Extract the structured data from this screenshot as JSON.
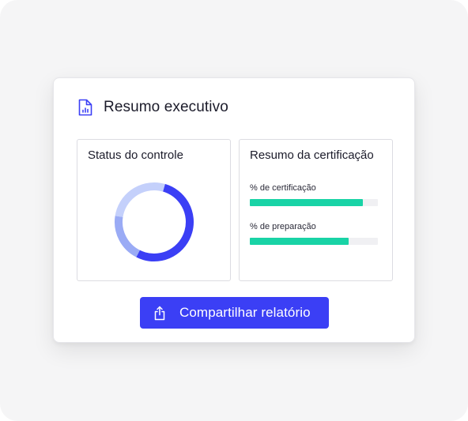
{
  "colors": {
    "accent": "#3b3ff5",
    "progress": "#19d3a6",
    "donut_dark": "#3b3ff5",
    "donut_mid": "#9aabf5",
    "donut_light": "#c4d0fb"
  },
  "icons": {
    "header": "document-chart-icon",
    "button": "share-upload-icon"
  },
  "card": {
    "title": "Resumo executivo"
  },
  "control_status": {
    "title": "Status do controle",
    "donut_segments": [
      {
        "color_key": "donut_dark",
        "fraction": 0.53
      },
      {
        "color_key": "donut_mid",
        "fraction": 0.2
      },
      {
        "color_key": "donut_light",
        "fraction": 0.27
      }
    ]
  },
  "certification": {
    "title": "Resumo da certificação",
    "metrics": [
      {
        "label": "% de certificação",
        "fraction": 0.88
      },
      {
        "label": "% de preparação",
        "fraction": 0.77
      }
    ]
  },
  "actions": {
    "share_label": "Compartilhar relatório"
  }
}
